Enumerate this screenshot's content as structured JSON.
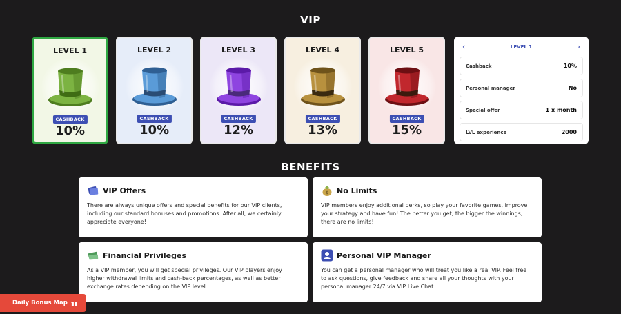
{
  "vip": {
    "title": "VIP"
  },
  "levels": [
    {
      "name": "LEVEL 1",
      "badge": "CASHBACK",
      "cashback": "10%",
      "bg": "#f2f7e6",
      "hat": "#7cb342",
      "hat_dark": "#4e7d1f",
      "band": "#3f6c14",
      "active": true
    },
    {
      "name": "LEVEL 2",
      "badge": "CASHBACK",
      "cashback": "10%",
      "bg": "#e6edf9",
      "hat": "#5a9bd8",
      "hat_dark": "#2f5f93",
      "band": "#2a4c74",
      "active": false
    },
    {
      "name": "LEVEL 3",
      "badge": "CASHBACK",
      "cashback": "12%",
      "bg": "#ece7f7",
      "hat": "#8e44e0",
      "hat_dark": "#5b1aa8",
      "band": "#4a2a7a",
      "active": false
    },
    {
      "name": "LEVEL 4",
      "badge": "CASHBACK",
      "cashback": "13%",
      "bg": "#f7efe0",
      "hat": "#b8913e",
      "hat_dark": "#6f531b",
      "band": "#3a2a10",
      "active": false
    },
    {
      "name": "LEVEL 5",
      "badge": "CASHBACK",
      "cashback": "15%",
      "bg": "#f9e6e6",
      "hat": "#c1272d",
      "hat_dark": "#6d0f13",
      "band": "#3b1a0d",
      "active": false
    }
  ],
  "panel": {
    "level": "LEVEL 1",
    "rows": [
      {
        "label": "Cashback",
        "value": "10%"
      },
      {
        "label": "Personal manager",
        "value": "No"
      },
      {
        "label": "Special offer",
        "value": "1 x month"
      },
      {
        "label": "LVL experience",
        "value": "2000"
      }
    ]
  },
  "benefits": {
    "title": "BENEFITS",
    "vip_offers": {
      "title": "VIP Offers",
      "text": "There are always unique offers and special benefits for our VIP clients, including our standard bonuses and promotions. After all, we certainly appreciate everyone!"
    },
    "no_limits": {
      "title": "No Limits",
      "text": "VIP members enjoy additional perks, so play your favorite games, improve your strategy and have fun! The better you get, the bigger the winnings, there are no limits!"
    },
    "financial": {
      "title": "Financial Privileges",
      "text": "As a VIP member, you will get special privileges. Our VIP players enjoy higher withdrawal limits and cash-back percentages, as well as better exchange rates depending on the VIP level."
    },
    "manager": {
      "title": "Personal VIP Manager",
      "text": "You can get a personal manager who will treat you like a real VIP. Feel free to ask questions, give feedback and share all your thoughts with your personal manager 24/7 via VIP Live Chat."
    }
  },
  "daily_bonus": {
    "label": "Daily Bonus Map",
    "icon": "gift-icon"
  },
  "colors": {
    "accent": "#3d4fb3",
    "active_border": "#2fa842",
    "bonus_button": "#e5493a"
  }
}
